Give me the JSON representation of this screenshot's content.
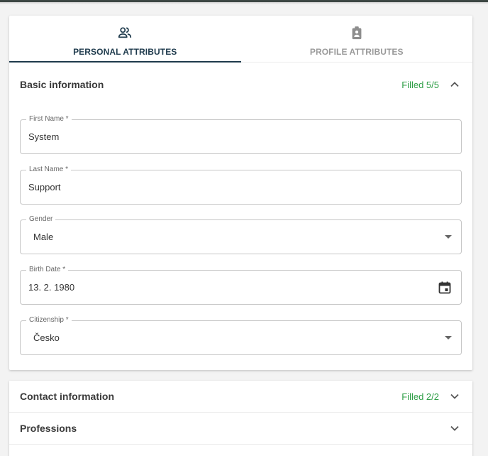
{
  "tabs": [
    {
      "label": "PERSONAL ATTRIBUTES",
      "icon": "people-icon",
      "active": true
    },
    {
      "label": "PROFILE ATTRIBUTES",
      "icon": "badge-icon",
      "active": false
    }
  ],
  "basic": {
    "title": "Basic information",
    "status": "Filled 5/5",
    "fields": {
      "first_name": {
        "label": "First Name *",
        "value": "System"
      },
      "last_name": {
        "label": "Last Name *",
        "value": "Support"
      },
      "gender": {
        "label": "Gender",
        "value": "Male"
      },
      "birth_date": {
        "label": "Birth Date *",
        "value": "13. 2. 1980"
      },
      "citizenship": {
        "label": "Citizenship *",
        "value": "Česko"
      }
    }
  },
  "contact": {
    "title": "Contact information",
    "status": "Filled 2/2"
  },
  "professions": {
    "title": "Professions"
  },
  "colors": {
    "accent": "#1e3a4c",
    "status_green": "#2e9e46"
  }
}
